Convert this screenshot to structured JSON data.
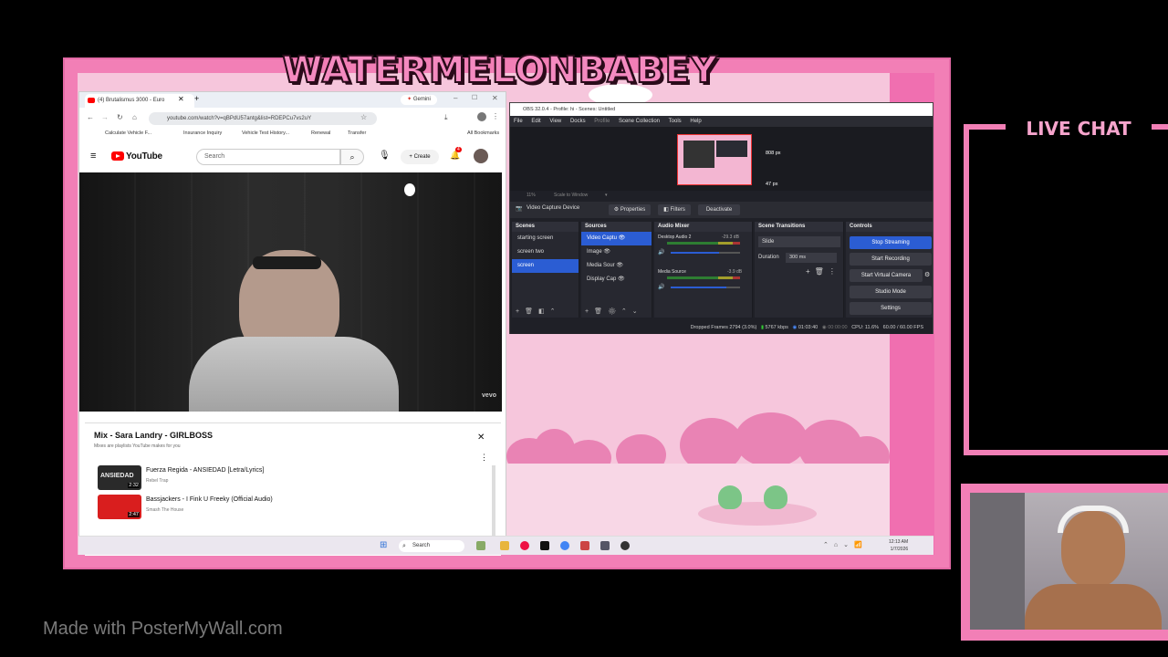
{
  "overlay": {
    "title": "WATERMELONBABEY",
    "chat_label": "LIVE CHAT",
    "watermark": "Made with PosterMyWall.com"
  },
  "browser": {
    "tab_title": "(4) Brutalismus 3000 - Euro",
    "gemini_label": "Gemini",
    "url": "youtube.com/watch?v=qBPdU57antg&list=RDEPCu7vs2uY",
    "bookmarks": [
      "Calculate Vehicle F...",
      "Insurance Inquiry",
      "Vehicle Test History...",
      "Renewal",
      "Transfer"
    ],
    "all_bookmarks": "All Bookmarks",
    "youtube": {
      "logo": "YouTube",
      "search_placeholder": "Search",
      "create_label": "Create",
      "notification_count": "4",
      "video_watermark": "vevo"
    },
    "playlist": {
      "title": "Mix - Sara Landry - GIRLBOSS",
      "subtitle": "Mixes are playlists YouTube makes for you",
      "items": [
        {
          "title": "Fuerza Regida - ANSIEDAD [Letra/Lyrics]",
          "channel": "Rebel Trap",
          "duration": "2:32",
          "thumb_text": "ANSIEDAD"
        },
        {
          "title": "Bassjackers - I Fink U Freeky (Official Audio)",
          "channel": "Smash The House",
          "duration": "2:47",
          "thumb_text": ""
        }
      ]
    }
  },
  "obs": {
    "window_title": "OBS 32.0.4 - Profile: hi - Scenes: Untitled",
    "menu": [
      "File",
      "Edit",
      "View",
      "Docks",
      "Profile",
      "Scene Collection",
      "Tools",
      "Help"
    ],
    "preview_labels": {
      "width": "808 px",
      "height": "47 px"
    },
    "zoom": "11%",
    "scale_mode": "Scale to Window",
    "source_name": "Video Capture Device",
    "buttons": {
      "properties": "Properties",
      "filters": "Filters",
      "deactivate": "Deactivate"
    },
    "scenes": {
      "header": "Scenes",
      "items": [
        "starting screen",
        "screen two",
        "screen"
      ],
      "selected": "screen"
    },
    "sources": {
      "header": "Sources",
      "items": [
        "Video Captu",
        "Image",
        "Media Sour",
        "Display Cap"
      ]
    },
    "audio_mixer": {
      "header": "Audio Mixer",
      "channels": [
        {
          "name": "Desktop Audio 2",
          "db": "-29.3 dB",
          "level": 0.7
        },
        {
          "name": "Media Source",
          "db": "-3.9 dB",
          "level": 0.8
        }
      ]
    },
    "transitions": {
      "header": "Scene Transitions",
      "type": "Slide",
      "duration_label": "Duration",
      "duration": "300 ms"
    },
    "controls": {
      "header": "Controls",
      "stop_streaming": "Stop Streaming",
      "start_recording": "Start Recording",
      "start_virtual_camera": "Start Virtual Camera",
      "studio_mode": "Studio Mode",
      "settings": "Settings"
    },
    "status": {
      "dropped_frames": "Dropped Frames 2794 (3.0%)",
      "bitrate": "5767 kbps",
      "stream_time": "01:03:40",
      "rec_time": "00:00:00",
      "cpu": "CPU: 11.6%",
      "fps": "60.00 / 60.00 FPS"
    }
  },
  "taskbar": {
    "search_label": "Search",
    "time": "12:13 AM",
    "date": "1/7/2026"
  },
  "colors": {
    "frame_pink": "#f27fb6",
    "obs_accent": "#2b5dd3"
  }
}
